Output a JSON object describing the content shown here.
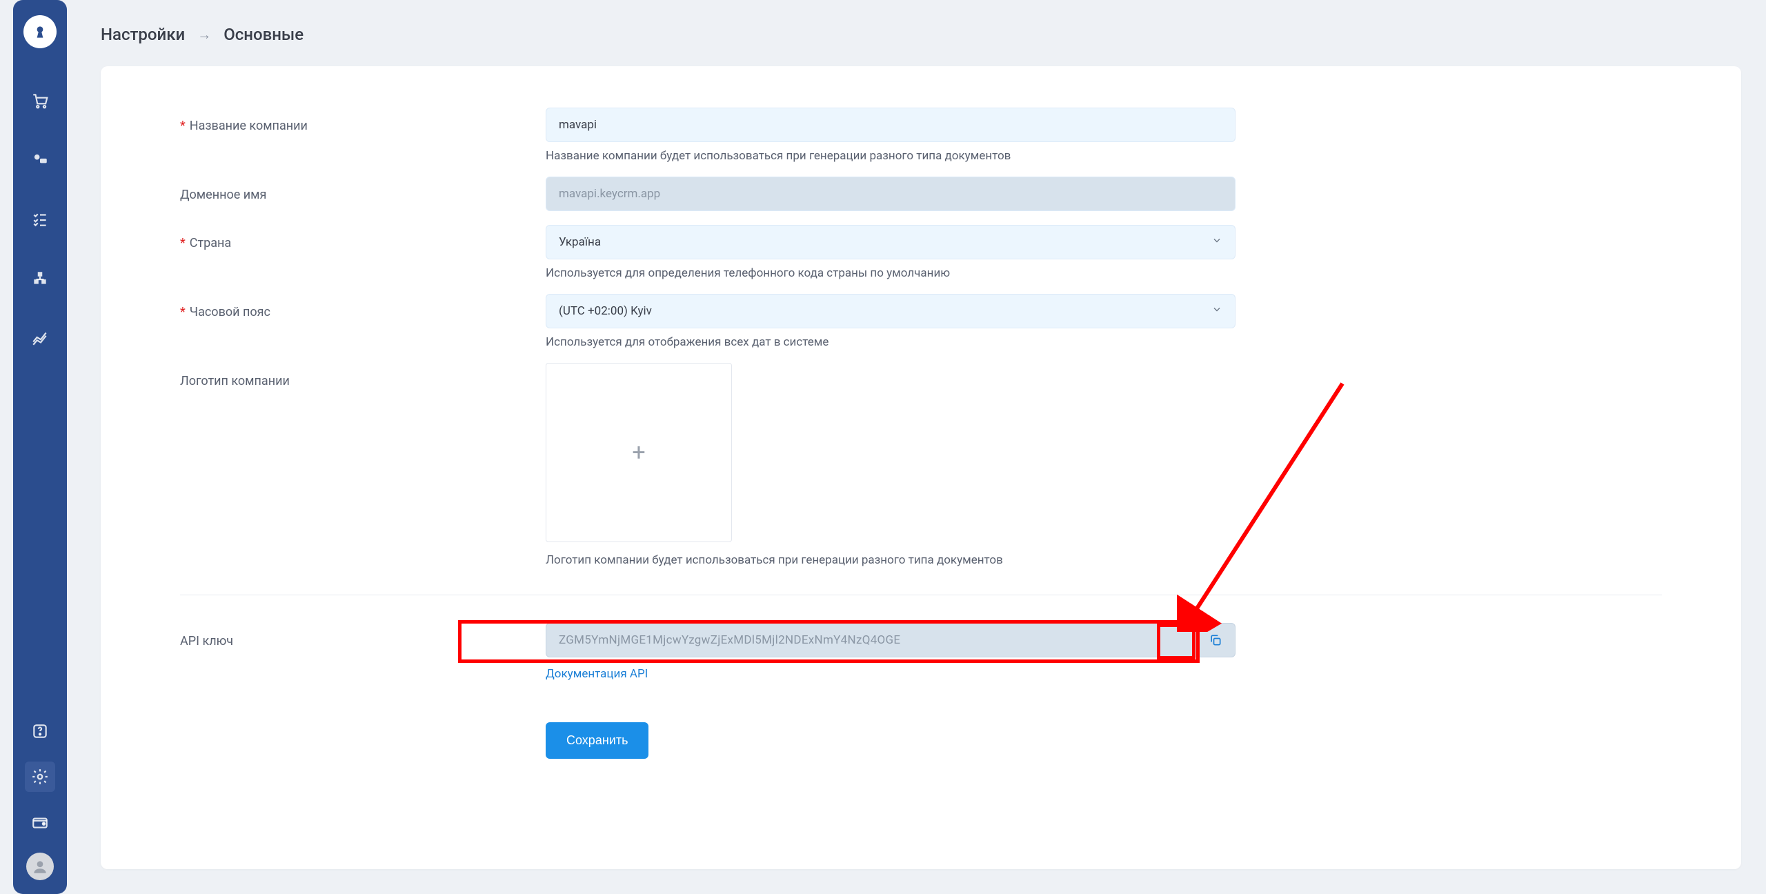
{
  "breadcrumb": {
    "root": "Настройки",
    "current": "Основные"
  },
  "sidebar": {
    "logo_tooltip": "KeyCRM",
    "items": [
      {
        "name": "cart-icon"
      },
      {
        "name": "chat-icon"
      },
      {
        "name": "tasks-icon"
      },
      {
        "name": "warehouse-icon"
      },
      {
        "name": "analytics-icon"
      }
    ],
    "bottom": [
      {
        "name": "help-icon"
      },
      {
        "name": "settings-icon",
        "active": true
      },
      {
        "name": "wallet-icon"
      }
    ]
  },
  "form": {
    "company_name": {
      "label": "Название компании",
      "value": "mavapi",
      "hint": "Название компании будет использоваться при генерации разного типа документов"
    },
    "domain": {
      "label": "Доменное имя",
      "value": "mavapi.keycrm.app"
    },
    "country": {
      "label": "Страна",
      "value": "Україна",
      "hint": "Используется для определения телефонного кода страны по умолчанию"
    },
    "timezone": {
      "label": "Часовой пояс",
      "value": "(UTC +02:00) Kyiv",
      "hint": "Используется для отображения всех дат в системе"
    },
    "logo": {
      "label": "Логотип компании",
      "hint": "Логотип компании будет использоваться при генерации разного типа документов"
    },
    "api": {
      "label": "API ключ",
      "value": "ZGM5YmNjMGE1MjcwYzgwZjExMDl5Mjl2NDExNmY4NzQ4OGE",
      "doc_link": "Документация API"
    },
    "save_label": "Сохранить"
  }
}
